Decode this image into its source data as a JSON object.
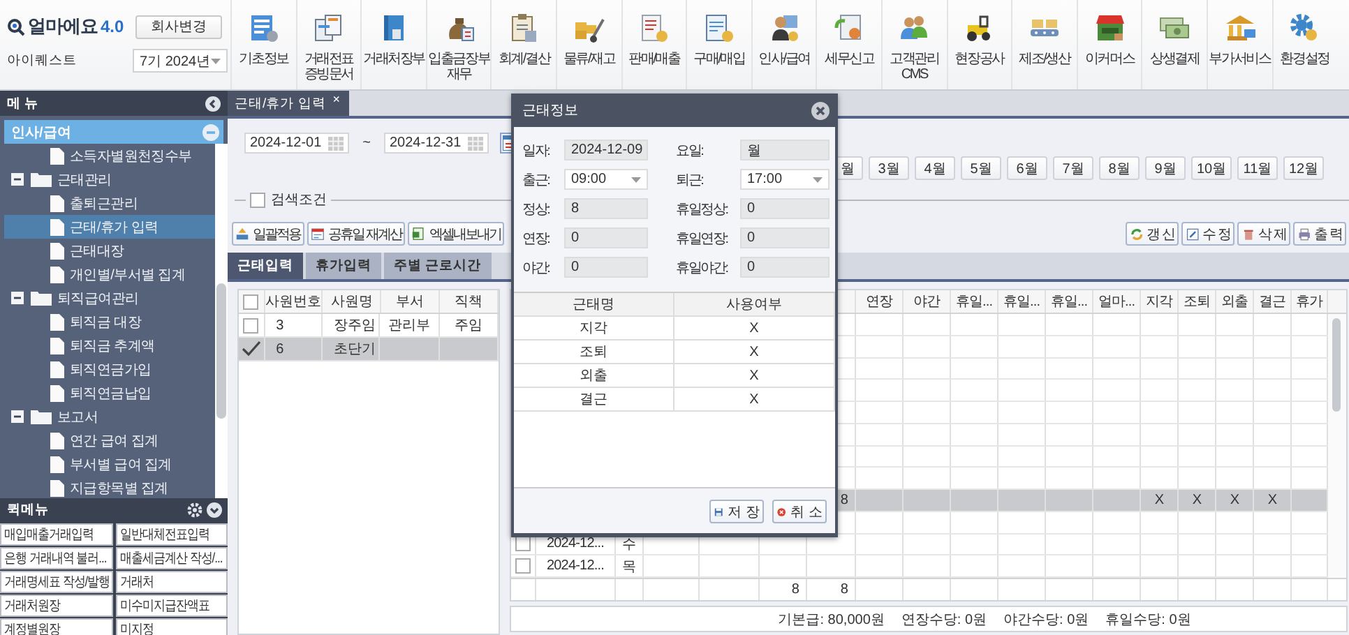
{
  "app": {
    "logo": "얼마에요",
    "version": "4.0",
    "change_company_button": "회사변경",
    "company": "아이퀘스트",
    "fiscal_year": "7기 2024년"
  },
  "toolbar": [
    {
      "lines": [
        "기초정보"
      ]
    },
    {
      "lines": [
        "거래전표",
        "증빙문서"
      ]
    },
    {
      "lines": [
        "거래처장부"
      ]
    },
    {
      "lines": [
        "입출금장부",
        "재무"
      ]
    },
    {
      "lines": [
        "회계/결산"
      ]
    },
    {
      "lines": [
        "물류/재고"
      ]
    },
    {
      "lines": [
        "판매/매출"
      ]
    },
    {
      "lines": [
        "구매/매입"
      ]
    },
    {
      "lines": [
        "인사/급여"
      ]
    },
    {
      "lines": [
        "세무신고"
      ]
    },
    {
      "lines": [
        "고객관리",
        "CMS"
      ]
    },
    {
      "lines": [
        "현장공사"
      ]
    },
    {
      "lines": [
        "제조/생산"
      ]
    },
    {
      "lines": [
        "이커머스"
      ]
    },
    {
      "lines": [
        "상생결제"
      ]
    },
    {
      "lines": [
        "부가서비스"
      ]
    },
    {
      "lines": [
        "환경설정"
      ]
    }
  ],
  "sidebar": {
    "header": "메 뉴",
    "section": {
      "label": "인사/급여",
      "expanded": true
    },
    "tree": [
      {
        "label": "소득자별원천징수부",
        "kind": "page",
        "selected": false
      },
      {
        "label": "근태관리",
        "kind": "folder",
        "expanded": true,
        "selected": false,
        "children": [
          {
            "label": "출퇴근관리",
            "kind": "page",
            "selected": false
          },
          {
            "label": "근태/휴가 입력",
            "kind": "page",
            "selected": true
          },
          {
            "label": "근태대장",
            "kind": "page",
            "selected": false
          },
          {
            "label": "개인별/부서별 집계",
            "kind": "page",
            "selected": false
          }
        ]
      },
      {
        "label": "퇴직급여관리",
        "kind": "folder",
        "expanded": true,
        "selected": false,
        "children": [
          {
            "label": "퇴직금 대장",
            "kind": "page",
            "selected": false
          },
          {
            "label": "퇴직금 추계액",
            "kind": "page",
            "selected": false
          },
          {
            "label": "퇴직연금가입",
            "kind": "page",
            "selected": false
          },
          {
            "label": "퇴직연금납입",
            "kind": "page",
            "selected": false
          }
        ]
      },
      {
        "label": "보고서",
        "kind": "folder",
        "expanded": true,
        "selected": false,
        "children": [
          {
            "label": "연간 급여 집계",
            "kind": "page",
            "selected": false
          },
          {
            "label": "부서별 급여 집계",
            "kind": "page",
            "selected": false
          },
          {
            "label": "지급항목별 집계",
            "kind": "page",
            "selected": false
          }
        ]
      }
    ],
    "quick_menu": {
      "header": "퀵메뉴",
      "items": [
        "매입매출거래입력",
        "일반대체전표입력",
        "은행 거래내역 불러...",
        "매출세금계산 작성/...",
        "거래명세표 작성/발행",
        "거래처",
        "거래처원장",
        "미수미지급잔액표",
        "계정별원장",
        "미지정"
      ]
    }
  },
  "tabs": [
    {
      "label": "근태/휴가 입력",
      "close": "×",
      "selected": true
    }
  ],
  "filter": {
    "date_from": "2024-12-01",
    "separator": "~",
    "date_to": "2024-12-31",
    "months": [
      "월",
      "3월",
      "4월",
      "5월",
      "6월",
      "7월",
      "8월",
      "9월",
      "10월",
      "11월",
      "12월"
    ],
    "search_conditions": {
      "label": "검색조건",
      "checked": false
    }
  },
  "actions_left": [
    {
      "label": "일괄적용",
      "kind": "apply"
    },
    {
      "label": "공휴일 재계산",
      "kind": "holiday"
    },
    {
      "label": "엑셀내보내기",
      "kind": "excel"
    }
  ],
  "actions_right": [
    {
      "label": "갱 신",
      "kind": "refresh"
    },
    {
      "label": "수 정",
      "kind": "edit"
    },
    {
      "label": "삭 제",
      "kind": "delete"
    },
    {
      "label": "출 력",
      "kind": "print"
    }
  ],
  "sub_tabs": [
    {
      "label": "근태입력",
      "selected": true
    },
    {
      "label": "휴가입력",
      "selected": false
    },
    {
      "label": "주별 근로시간",
      "selected": false
    }
  ],
  "employee_grid": {
    "all_checked": false,
    "columns": [
      "사원번호",
      "사원명",
      "부서",
      "직책"
    ],
    "rows": [
      {
        "checked": false,
        "selected": false,
        "cells": [
          "3",
          "장주임",
          "관리부",
          "주임"
        ]
      },
      {
        "checked": true,
        "selected": true,
        "cells": [
          "6",
          "초단기"
        ]
      }
    ]
  },
  "attendance_grid": {
    "headers": [
      "연장",
      "야간",
      "휴일...",
      "휴일...",
      "휴일...",
      "얼마...",
      "지각",
      "조퇴",
      "외출",
      "결근",
      "휴가"
    ],
    "rows": [
      {
        "selected": false
      },
      {
        "selected": false
      },
      {
        "selected": false
      },
      {
        "selected": false
      },
      {
        "selected": false
      },
      {
        "selected": false
      },
      {
        "selected": false
      },
      {
        "selected": false
      },
      {
        "selected": true,
        "column_7": "8",
        "late": "X",
        "early": "X",
        "out": "X",
        "absent": "X"
      },
      {
        "selected": false
      },
      {
        "selected": false,
        "checked": false,
        "date": "2024-12...",
        "weekday": "수"
      },
      {
        "selected": false,
        "checked": false,
        "date": "2024-12...",
        "weekday": "목"
      }
    ],
    "totals": {
      "column_6": "8",
      "column_7": "8"
    }
  },
  "summary": [
    "기본급: 80,000원",
    "연장수당: 0원",
    "야간수당: 0원",
    "휴일수당: 0원"
  ],
  "dialog": {
    "title": "근태정보",
    "fields": [
      {
        "label": "일자:",
        "value": "2024-12-09",
        "kind": "readonly"
      },
      {
        "label": "요일:",
        "value": "월",
        "kind": "readonly"
      },
      {
        "label": "출근:",
        "value": "09:00",
        "kind": "select"
      },
      {
        "label": "퇴근:",
        "value": "17:00",
        "kind": "select"
      },
      {
        "label": "정상:",
        "value": "8",
        "kind": "readonly"
      },
      {
        "label": "휴일정상:",
        "value": "0",
        "kind": "readonly"
      },
      {
        "label": "연장:",
        "value": "0",
        "kind": "readonly"
      },
      {
        "label": "휴일연장:",
        "value": "0",
        "kind": "readonly"
      },
      {
        "label": "야간:",
        "value": "0",
        "kind": "readonly"
      },
      {
        "label": "휴일야간:",
        "value": "0",
        "kind": "readonly"
      }
    ],
    "table": {
      "columns": [
        "근태명",
        "사용여부"
      ],
      "rows": [
        [
          "지각",
          "X"
        ],
        [
          "조퇴",
          "X"
        ],
        [
          "외출",
          "X"
        ],
        [
          "결근",
          "X"
        ]
      ]
    },
    "buttons": [
      {
        "label": "저 장",
        "kind": "save"
      },
      {
        "label": "취 소",
        "kind": "cancel"
      }
    ]
  }
}
